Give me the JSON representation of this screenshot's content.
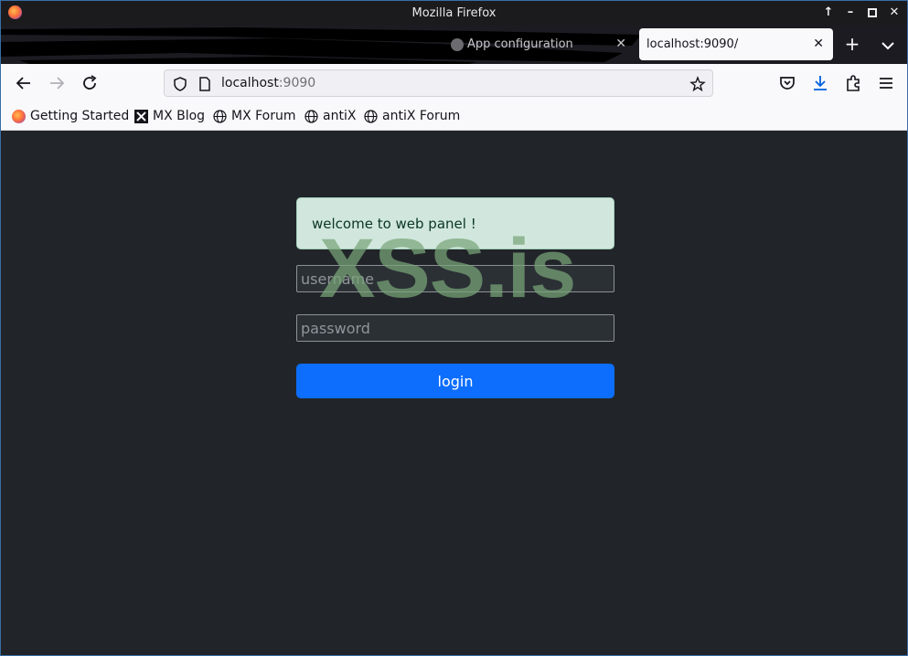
{
  "window": {
    "title": "Mozilla Firefox"
  },
  "tabs": [
    {
      "label": "App configuration",
      "active": false
    },
    {
      "label": "localhost:9090/",
      "active": true
    }
  ],
  "navbar": {
    "url_host": "localhost",
    "url_port": ":9090"
  },
  "bookmarks": [
    {
      "label": "Getting Started",
      "icon": "firefox-icon"
    },
    {
      "label": "MX Blog",
      "icon": "mx-logo-icon"
    },
    {
      "label": "MX Forum",
      "icon": "globe-icon"
    },
    {
      "label": "antiX",
      "icon": "globe-icon"
    },
    {
      "label": "antiX Forum",
      "icon": "globe-icon"
    }
  ],
  "page": {
    "alert_text": "welcome to web panel !",
    "username_placeholder": "username",
    "password_placeholder": "password",
    "login_label": "login",
    "watermark": "XSS.is"
  },
  "colors": {
    "page_bg": "#212529",
    "alert_bg": "#d1e7dd",
    "alert_text": "#0a3622",
    "button_primary": "#0d6efd",
    "input_bg": "#2b3035"
  }
}
